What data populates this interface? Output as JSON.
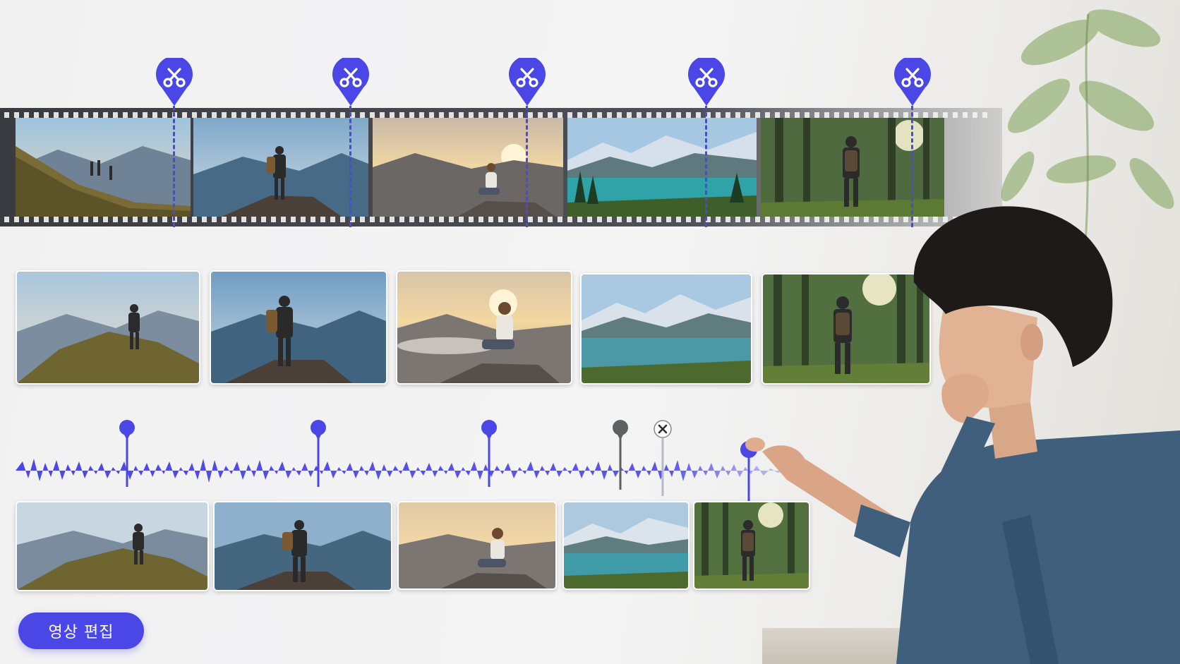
{
  "editor": {
    "edit_button_label": "영상 편집",
    "accent_color": "#4a47e6",
    "muted_marker_color": "#5f6064"
  },
  "icons": {
    "cut": "scissors-icon",
    "remove": "close-icon"
  },
  "scenes": [
    "hikers-on-ridge",
    "hiker-on-summit-rock",
    "woman-sitting-sunrise",
    "alpine-lake",
    "hiker-in-forest"
  ]
}
